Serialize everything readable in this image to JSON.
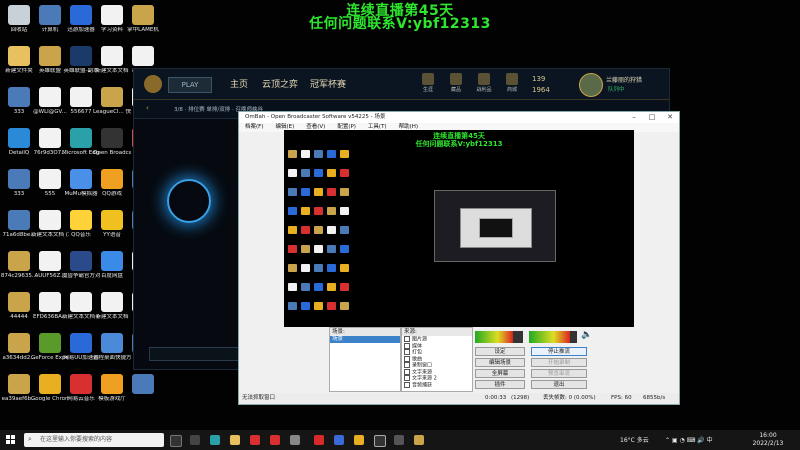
{
  "overlay": {
    "line1": "连续直播第45天",
    "line2": "任何问题联系V:ybf12313"
  },
  "desktop_icons": [
    {
      "label": "回收站",
      "color": "#c8d0d8"
    },
    {
      "label": "计算机",
      "color": "#4a7ab8"
    },
    {
      "label": "迅游加速器",
      "color": "#2a6ad8"
    },
    {
      "label": "学习资料",
      "color": "#f2f2f2"
    },
    {
      "label": "掌中LAME机",
      "color": "#c9a44a"
    },
    {
      "label": "新建文件夹",
      "color": "#e8c060"
    },
    {
      "label": "英雄联盟",
      "color": "#c9a44a"
    },
    {
      "label": "英雄联盟-副本",
      "color": "#1a3a6a"
    },
    {
      "label": "新建文本文档",
      "color": "#f2f2f2"
    },
    {
      "label": "新建文本",
      "color": "#f2f2f2"
    },
    {
      "label": "333",
      "color": "#4a7ab8"
    },
    {
      "label": "@WLI@GV...",
      "color": "#f2f2f2"
    },
    {
      "label": "556677",
      "color": "#f2f2f2"
    },
    {
      "label": "LeagueCl... 快捷方式",
      "color": "#c9a44a"
    },
    {
      "label": "222",
      "color": "#f2f2f2"
    },
    {
      "label": "DetailQ",
      "color": "#2a8ad8"
    },
    {
      "label": "76r9d3O7...",
      "color": "#f2f2f2"
    },
    {
      "label": "Microsoft Edge",
      "color": "#2aa0a8"
    },
    {
      "label": "Open Broadcast...",
      "color": "#333"
    },
    {
      "label": "",
      "color": "#d84a4a"
    },
    {
      "label": "333",
      "color": "#4a7ab8"
    },
    {
      "label": "555",
      "color": "#f2f2f2"
    },
    {
      "label": "MuMu模拟器",
      "color": "#4a90e8"
    },
    {
      "label": "QQ游戏",
      "color": "#f0a020"
    },
    {
      "label": "",
      "color": "#4a7ab8"
    },
    {
      "label": "71a6d8be...",
      "color": "#4a7ab8"
    },
    {
      "label": "新建文本文档 (3)",
      "color": "#f2f2f2"
    },
    {
      "label": "QQ音乐",
      "color": "#ffd23a"
    },
    {
      "label": "YY语音",
      "color": "#f0c020"
    },
    {
      "label": "",
      "color": "#4a7ab8"
    },
    {
      "label": "874c29635...",
      "color": "#c9a44a"
    },
    {
      "label": "AUUF56Z...",
      "color": "#f2f2f2"
    },
    {
      "label": "魔兽争霸官方对战平台",
      "color": "#2a4a8a"
    },
    {
      "label": "百度网盘",
      "color": "#3a8ae8"
    },
    {
      "label": "Ep 游戏",
      "color": "#f2f2f2"
    },
    {
      "label": "44444",
      "color": "#c9a44a"
    },
    {
      "label": "EFD636BA...",
      "color": "#f2f2f2"
    },
    {
      "label": "新建文本文档 (4)",
      "color": "#f2f2f2"
    },
    {
      "label": "新建文本文档",
      "color": "#f2f2f2"
    },
    {
      "label": "",
      "color": "#f2f2f2"
    },
    {
      "label": "a3634dd2...",
      "color": "#c9a44a"
    },
    {
      "label": "GeForce Experience",
      "color": "#5a9a2a"
    },
    {
      "label": "网易UU加速器",
      "color": "#2a6ad8"
    },
    {
      "label": "远程桌面快捷方式",
      "color": "#4a8ad8"
    },
    {
      "label": "",
      "color": "#4a7ab8"
    },
    {
      "label": "ea39aef6b...",
      "color": "#c9a44a"
    },
    {
      "label": "Google Chrome",
      "color": "#e8b020"
    },
    {
      "label": "网易云音乐",
      "color": "#d83030"
    },
    {
      "label": "模板游戏厅",
      "color": "#f0a020"
    },
    {
      "label": "",
      "color": "#4a7ab8"
    }
  ],
  "game": {
    "play_label": "PLAY",
    "nav": [
      "主页",
      "云顶之弈",
      "冠军杯赛"
    ],
    "tray": [
      "生涯",
      "藏品",
      "战利品",
      "商城"
    ],
    "currency1": "139",
    "currency2": "1964",
    "username": "兰藤丽的狩猎",
    "status": "队列中",
    "sub_text": "3/8 · 排位赛 单排/双排 · 召唤师峡谷"
  },
  "obs": {
    "title": "OmBah - Open Broadcaster Software v54225 - 场景",
    "menu": [
      "档案(F)",
      "编辑(E)",
      "查看(V)",
      "配置(P)",
      "工具(T)",
      "帮助(H)"
    ],
    "preview_line1": "连续直播第45天",
    "preview_line2": "任何问题联系V:ybf12313",
    "scenes_header": "场景:",
    "scenes_selected": "场景",
    "sources_header": "来源:",
    "sources": [
      "图片源",
      "媒体",
      "打包",
      "歌曲",
      "录制窗口",
      "文字来源",
      "文字来源 2",
      "音频捕获"
    ],
    "buttons": {
      "settings": "设定",
      "stop_stream": "停止推流",
      "edit_scene": "编辑场景",
      "start_record": "开始录制",
      "fullscreen": "全屏幕",
      "preview": "预览串流",
      "plugins": "插件",
      "exit": "退出"
    },
    "status": {
      "left": "无法抓取窗口",
      "time": "0:00:33",
      "frames": "(1298)",
      "dropped": "丢失帧数: 0 (0.00%)",
      "fps": "FPS: 60",
      "rate": "6855b/s"
    }
  },
  "taskbar": {
    "search_placeholder": "在这里输入你要搜索的内容",
    "weather": "16°C 多云",
    "time": "16:00",
    "date": "2022/2/13"
  }
}
